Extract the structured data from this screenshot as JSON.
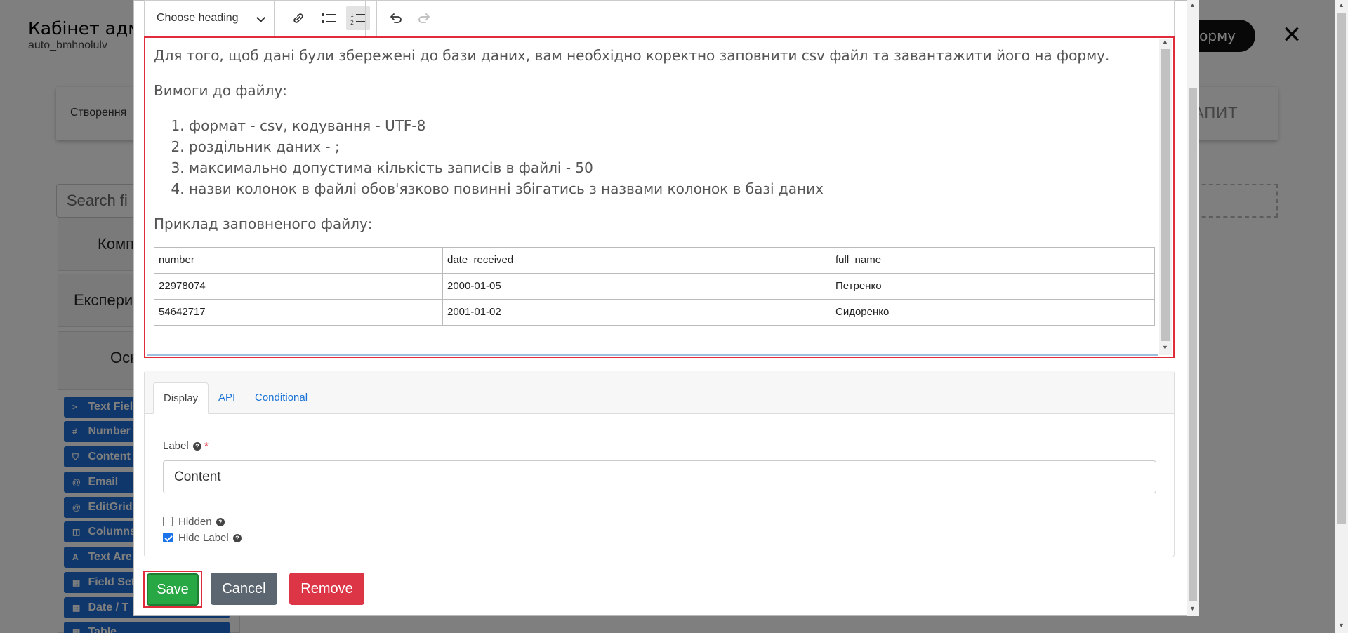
{
  "background": {
    "title": "Кабінет адм",
    "subtitle": "auto_bmhnolulv",
    "header_button": "орму",
    "card_text": "Створення",
    "card_right": "АПИТ",
    "search_placeholder": "Search fi",
    "accordions": [
      "Комп",
      "Експери",
      "Осн"
    ],
    "palette": [
      {
        "icon": "terminal-icon",
        "glyph": ">_",
        "label": "Text Fiel"
      },
      {
        "icon": "hash-icon",
        "glyph": "#",
        "label": "Number"
      },
      {
        "icon": "html5-icon",
        "glyph": "⛉",
        "label": "Content"
      },
      {
        "icon": "at-icon",
        "glyph": "@",
        "label": "Email"
      },
      {
        "icon": "at-icon",
        "glyph": "@",
        "label": "EditGrid"
      },
      {
        "icon": "columns-icon",
        "glyph": "◫",
        "label": "Columns"
      },
      {
        "icon": "font-icon",
        "glyph": "A",
        "label": "Text Are"
      },
      {
        "icon": "th-large-icon",
        "glyph": "▦",
        "label": "Field Set"
      },
      {
        "icon": "calendar-icon",
        "glyph": "▦",
        "label": "Date / T"
      },
      {
        "icon": "table-icon",
        "glyph": "▦",
        "label": "Table"
      }
    ]
  },
  "toolbar": {
    "heading_label": "Choose heading"
  },
  "editor": {
    "intro": "Для того, щоб дані були збережені до бази даних, вам необхідно коректно заповнити csv файл та завантажити його на форму.",
    "requirements_title": "Вимоги до файлу:",
    "requirements": [
      "формат - csv, кодування - UTF-8",
      "роздільник даних - ;",
      "максимально допустима кількість записів в файлі - 50",
      "назви колонок в файлі обов'язково повинні збігатись з назвами колонок в базі даних"
    ],
    "example_title": "Приклад заповненого файлу:",
    "table": {
      "headers": [
        "number",
        "date_received",
        "full_name"
      ],
      "rows": [
        [
          "22978074",
          "2000-01-05",
          "Петренко"
        ],
        [
          "54642717",
          "2001-01-02",
          "Сидоренко"
        ]
      ]
    }
  },
  "tabs": [
    {
      "label": "Display",
      "active": true
    },
    {
      "label": "API",
      "active": false
    },
    {
      "label": "Conditional",
      "active": false
    }
  ],
  "form": {
    "label_title": "Label",
    "label_value": "Content",
    "hidden_label": "Hidden",
    "hidden_checked": false,
    "hide_label_label": "Hide Label",
    "hide_label_checked": true
  },
  "actions": {
    "save": "Save",
    "cancel": "Cancel",
    "remove": "Remove"
  },
  "colors": {
    "save": "#28a745",
    "cancel": "#5c6670",
    "remove": "#dc3545",
    "highlight": "#e02b3a",
    "link": "#1a73d6"
  }
}
